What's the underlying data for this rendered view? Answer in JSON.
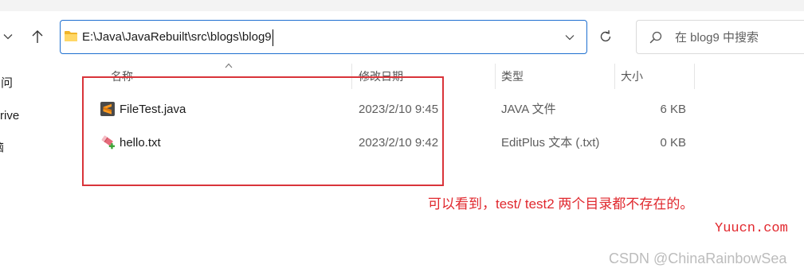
{
  "navigation": {
    "recent_icon": "chevron-down-icon",
    "up_icon": "arrow-up-icon"
  },
  "address_bar": {
    "folder_icon": "folder-icon",
    "path": "E:\\Java\\JavaRebuilt\\src\\blogs\\blog9",
    "dropdown_icon": "chevron-down-icon"
  },
  "refresh": {
    "icon": "refresh-icon"
  },
  "search": {
    "icon": "search-icon",
    "placeholder": "在 blog9 中搜索",
    "value": ""
  },
  "sidebar": {
    "items": [
      {
        "label": "问"
      },
      {
        "label": "rive"
      },
      {
        "label": "脑"
      }
    ]
  },
  "columns": [
    {
      "label": "名称"
    },
    {
      "label": "修改日期"
    },
    {
      "label": "类型"
    },
    {
      "label": "大小"
    }
  ],
  "sort_icon": "chevron-up-icon",
  "files": [
    {
      "name": "FileTest.java",
      "modified": "2023/2/10 9:45",
      "type": "JAVA 文件",
      "size": "6 KB",
      "icon": "sublime-text-file-icon"
    },
    {
      "name": "hello.txt",
      "modified": "2023/2/10 9:42",
      "type": "EditPlus 文本 (.txt)",
      "size": "0 KB",
      "icon": "editplus-file-icon"
    }
  ],
  "annotation": {
    "text": "可以看到，test/ test2 两个目录都不存在的。"
  },
  "watermarks": {
    "site": "Yuucn.com",
    "credit": "CSDN @ChinaRainbowSea"
  },
  "colors": {
    "accent": "#1e6fd0",
    "annotation_red": "#e0282e",
    "folder_yellow": "#ffd766"
  }
}
